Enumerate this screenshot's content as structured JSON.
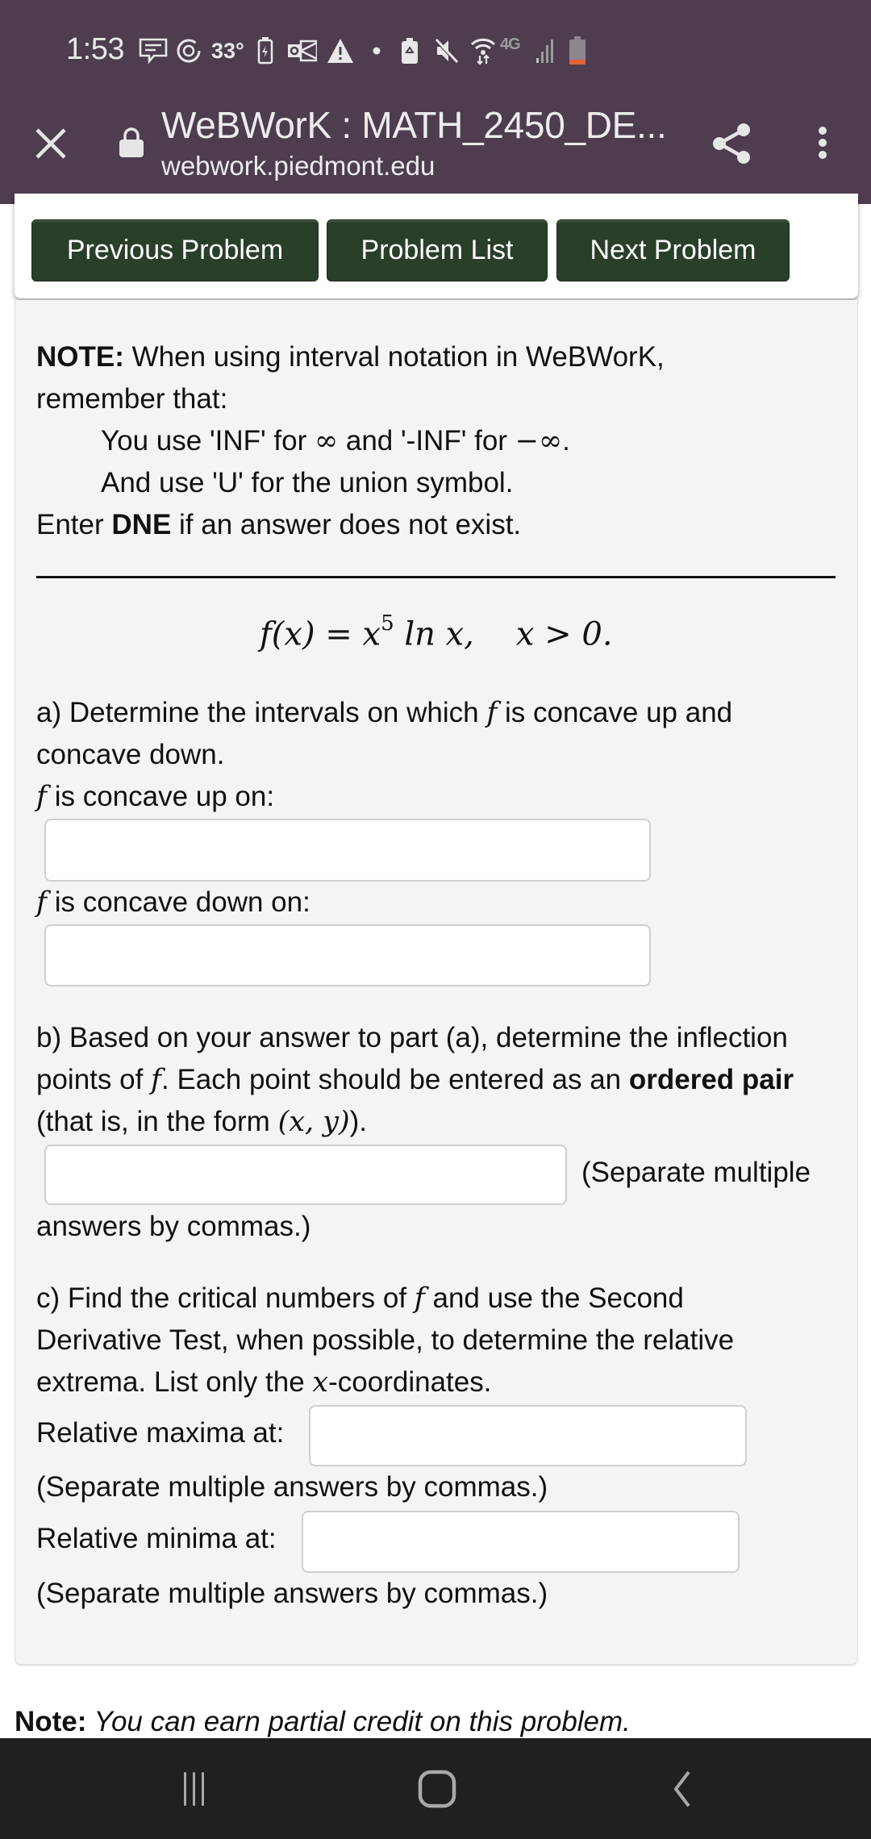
{
  "status_bar": {
    "time": "1:53",
    "temperature": "33°",
    "network_label": "4G",
    "icons": [
      "message-icon",
      "sync-icon",
      "battery-charging-icon",
      "outlook-icon",
      "warning-icon",
      "dot-icon",
      "battery-saver-icon",
      "mute-icon",
      "wifi-data-icon",
      "signal-icon",
      "battery-low-icon"
    ],
    "battery_color": "#e0623d"
  },
  "browser": {
    "title": "WeBWorK : MATH_2450_DE...",
    "url": "webwork.piedmont.edu",
    "header_color": "#4d3d4f"
  },
  "nav": {
    "previous_label": "Previous Problem",
    "list_label": "Problem List",
    "next_label": "Next Problem",
    "button_color": "#2a3f2a"
  },
  "problem": {
    "note_bold": "NOTE:",
    "note_line1": " When using interval notation in WeBWorK,",
    "note_line2": "remember that:",
    "note_inf_a": "You use 'INF' for ",
    "note_inf_sym": "∞",
    "note_inf_b": " and '-INF' for ",
    "note_neginf_sym": "−∞",
    "note_inf_end": ".",
    "note_union": "And use 'U' for the union symbol.",
    "dne_a": "Enter ",
    "dne_bold": "DNE",
    "dne_b": " if an answer does not exist.",
    "formula": {
      "lhs": "f(x) = x",
      "exponent": "5",
      "rhs": " ln x,",
      "domain": "x > 0."
    },
    "part_a": {
      "line1_a": "a) Determine the intervals on which ",
      "f": "f",
      "line1_b": " is concave up and",
      "line2": "concave down.",
      "up_label": " is concave up on:",
      "down_label": " is concave down on:",
      "up_value": "",
      "down_value": ""
    },
    "part_b": {
      "line1": "b) Based on your answer to part (a), determine the inflection",
      "line2_a": "points of ",
      "line2_b": ". Each point should be entered as an ",
      "line2_bold": "ordered pair",
      "line3_a": "(that is, in the form ",
      "line3_math": "(x, y)",
      "line3_b": ").",
      "hint_a": "(Separate multiple",
      "hint_b": "answers by commas.)",
      "value": ""
    },
    "part_c": {
      "line1_a": "c) Find the critical numbers of ",
      "line1_b": " and use the Second",
      "line2": "Derivative Test, when possible, to determine the relative",
      "line3_a": "extrema. List only the ",
      "line3_math": "x",
      "line3_b": "-coordinates.",
      "max_label": "Relative maxima at:",
      "min_label": "Relative minima at:",
      "hint": "(Separate multiple answers by commas.)",
      "max_value": "",
      "min_value": ""
    }
  },
  "footer": {
    "note_bold": "Note:",
    "note_text": " You can earn partial credit on this problem."
  },
  "system_nav": {
    "recents": "recents-icon",
    "home": "home-icon",
    "back": "back-icon"
  }
}
